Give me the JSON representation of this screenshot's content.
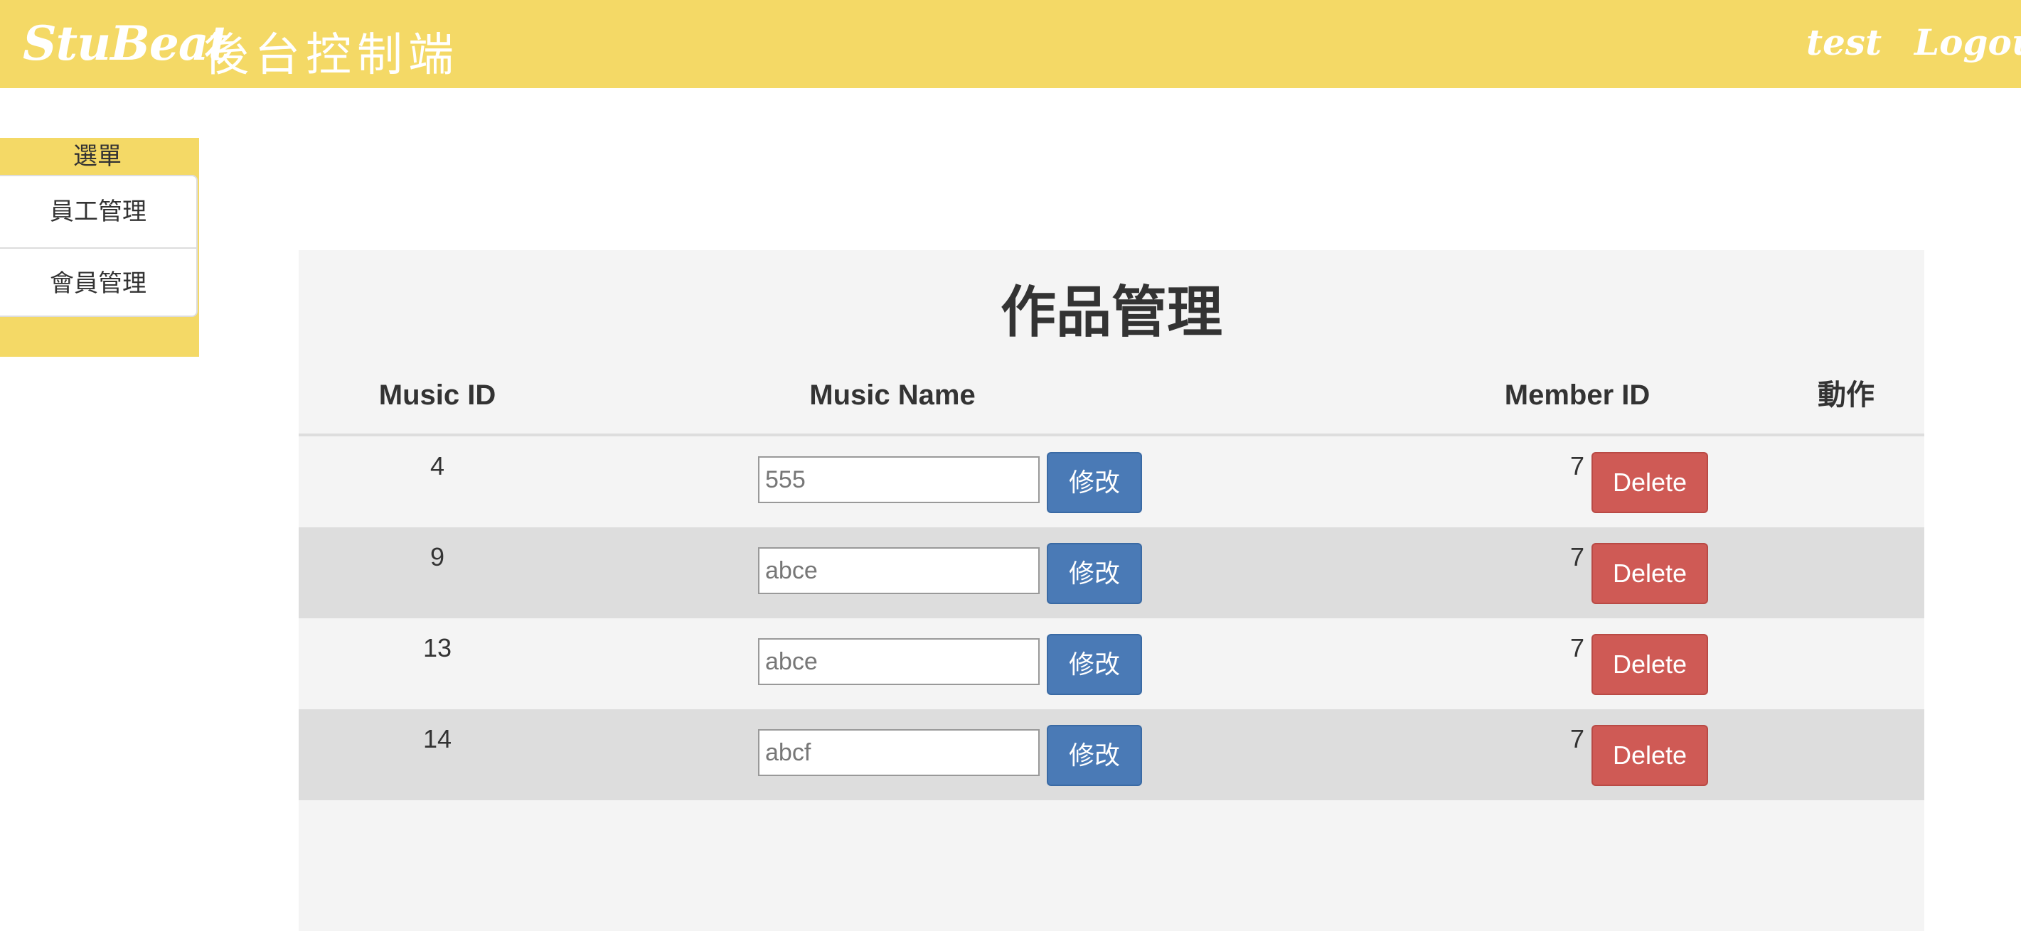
{
  "navbar": {
    "brand": "StuBeat",
    "subtitle": "後台控制端",
    "user_label": "test",
    "logout_label": "Logout"
  },
  "sidebar": {
    "title": "選單",
    "items": [
      {
        "label": "員工管理"
      },
      {
        "label": "會員管理"
      }
    ]
  },
  "main": {
    "title": "作品管理",
    "columns": [
      "Music ID",
      "Music Name",
      "Member ID",
      "動作"
    ],
    "rows": [
      {
        "music_id": "4",
        "music_name": "555",
        "member_id": "7",
        "edit_label": "修改",
        "delete_label": "Delete"
      },
      {
        "music_id": "9",
        "music_name": "abce",
        "member_id": "7",
        "edit_label": "修改",
        "delete_label": "Delete"
      },
      {
        "music_id": "13",
        "music_name": "abce",
        "member_id": "7",
        "edit_label": "修改",
        "delete_label": "Delete"
      },
      {
        "music_id": "14",
        "music_name": "abcf",
        "member_id": "7",
        "edit_label": "修改",
        "delete_label": "Delete"
      }
    ]
  },
  "colors": {
    "accent_yellow": "#f4d966",
    "edit_button": "#4a7ab6",
    "delete_button": "#cf5a55",
    "panel_bg": "#f4f4f4",
    "row_alt_bg": "#dddddd"
  }
}
